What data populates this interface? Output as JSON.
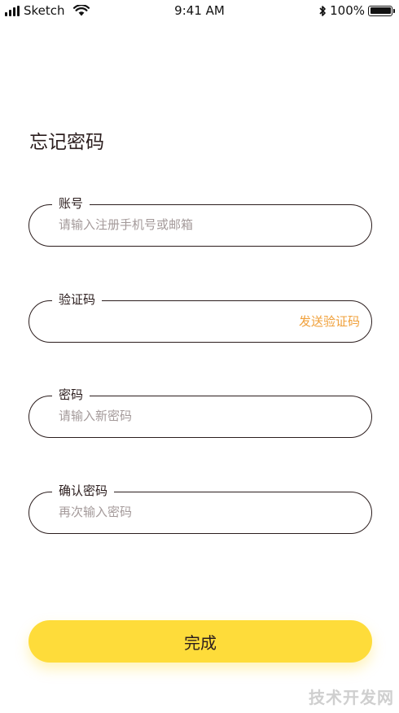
{
  "status_bar": {
    "carrier": "Sketch",
    "time": "9:41 AM",
    "battery": "100%",
    "battery_level": 1.0
  },
  "page": {
    "title": "忘记密码"
  },
  "form": {
    "account": {
      "label": "账号",
      "placeholder": "请输入注册手机号或邮箱",
      "value": ""
    },
    "code": {
      "label": "验证码",
      "placeholder": "",
      "value": "",
      "send_label": "发送验证码"
    },
    "password": {
      "label": "密码",
      "placeholder": "请输入新密码",
      "value": ""
    },
    "confirm": {
      "label": "确认密码",
      "placeholder": "再次输入密码",
      "value": ""
    }
  },
  "submit_label": "完成",
  "watermark": "技术开发网",
  "colors": {
    "accent": "#fedc3a",
    "link": "#f0a03a",
    "text": "#2b1d1d",
    "placeholder": "#a49a9a"
  }
}
